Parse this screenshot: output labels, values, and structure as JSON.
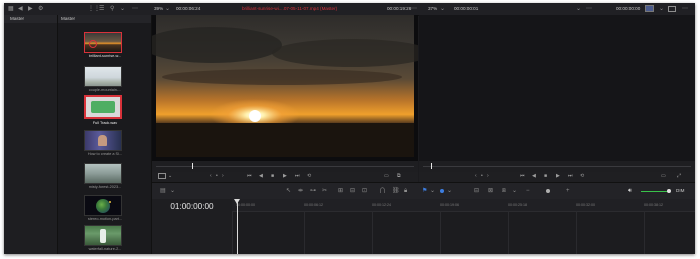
{
  "topbar": {
    "zoom_left": "39%",
    "timecode_left": "00:00:06:24",
    "clip_title": "brilliant-sunrise-wi....07-05-11-07.mp4 (Master)",
    "timecode_mid": "00:00:19:26",
    "zoom_right": "37%",
    "timecode_right": "00:00:00:01",
    "timecode_far": "00:00:00:00"
  },
  "sidebar": {
    "header": "Master"
  },
  "media_pool": {
    "header": "Master",
    "items": [
      {
        "label": "brilliant-sunrise-w...",
        "selected": true
      },
      {
        "label": "couple-mountain-..."
      },
      {
        "label": "Full Track.wav",
        "selected": true,
        "bright": true
      },
      {
        "label": "How to create a Sl..."
      },
      {
        "label": "misty-forest-2023..."
      },
      {
        "label": "stereo-motion-part..."
      },
      {
        "label": "waterfall-nature-2..."
      }
    ]
  },
  "timeline": {
    "timecode": "01:00:00:00",
    "ruler_labels": [
      "00:00:00:00",
      "00:00:06:12",
      "00:00:12:24",
      "00:00:19:06",
      "00:00:25:18",
      "00:00:32:00",
      "00:00:38:12"
    ]
  },
  "toolbar": {
    "dim_label": "DIM"
  },
  "icons": {
    "play": "play-icon",
    "stop": "stop-icon",
    "loop": "loop-icon",
    "volume": "speaker-icon",
    "snap": "magnet-icon",
    "flag": "flag-icon"
  },
  "colors": {
    "accent_red": "#d8323a",
    "accent_blue": "#3d7ee0",
    "accent_green": "#39c24a",
    "background": "#1b1b1e"
  }
}
